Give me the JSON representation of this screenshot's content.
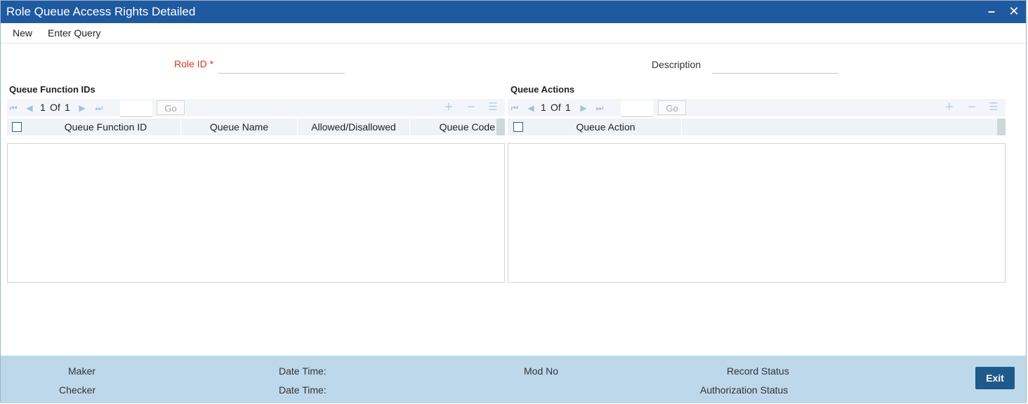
{
  "window": {
    "title": "Role Queue Access Rights Detailed",
    "minimize_glyph": "–",
    "close_glyph": "✕"
  },
  "toolbar": {
    "new_label": "New",
    "enter_query_label": "Enter Query"
  },
  "form": {
    "role_id_label": "Role ID",
    "required_mark": "*",
    "role_id_value": "",
    "description_label": "Description",
    "description_value": ""
  },
  "queue_function_grid": {
    "title": "Queue Function IDs",
    "page_current": "1",
    "page_of": "Of",
    "page_total": "1",
    "go_label": "Go",
    "columns": [
      "Queue Function ID",
      "Queue Name",
      "Allowed/Disallowed",
      "Queue Code"
    ],
    "rows": []
  },
  "queue_actions_grid": {
    "title": "Queue Actions",
    "page_current": "1",
    "page_of": "Of",
    "page_total": "1",
    "go_label": "Go",
    "columns": [
      "Queue Action"
    ],
    "rows": []
  },
  "pager_icons": {
    "first": "first-page-icon",
    "prev": "prev-page-icon",
    "next": "next-page-icon",
    "last": "last-page-icon",
    "add": "add-row-icon",
    "delete": "delete-row-icon",
    "details": "row-details-icon"
  },
  "footer": {
    "maker_label": "Maker",
    "checker_label": "Checker",
    "maker_datetime_label": "Date Time:",
    "checker_datetime_label": "Date Time:",
    "mod_no_label": "Mod No",
    "record_status_label": "Record Status",
    "authorization_status_label": "Authorization Status",
    "exit_label": "Exit"
  },
  "colors": {
    "titlebar": "#1f5aa1",
    "footer": "#bdd8eb",
    "exit_button": "#1f5a8b",
    "required": "#e0341a"
  }
}
